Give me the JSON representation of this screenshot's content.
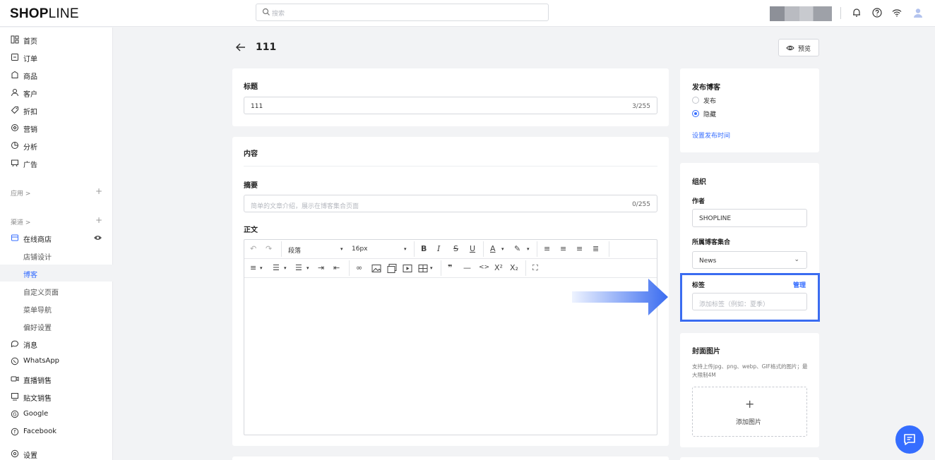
{
  "header": {
    "logo_bold": "SHOP",
    "logo_light": "LINE",
    "search_placeholder": "搜索"
  },
  "sidebar": {
    "items": [
      {
        "label": "首页",
        "icon": "home-icon"
      },
      {
        "label": "订单",
        "icon": "order-icon"
      },
      {
        "label": "商品",
        "icon": "product-icon"
      },
      {
        "label": "客户",
        "icon": "customer-icon"
      },
      {
        "label": "折扣",
        "icon": "discount-icon"
      },
      {
        "label": "营销",
        "icon": "marketing-icon"
      },
      {
        "label": "分析",
        "icon": "analytics-icon"
      },
      {
        "label": "广告",
        "icon": "ads-icon"
      }
    ],
    "apps_label": "应用 >",
    "channels_label": "渠道 >",
    "online_store": "在线商店",
    "store_subitems": [
      "店铺设计",
      "博客",
      "自定义页面",
      "菜单导航",
      "偏好设置"
    ],
    "active_subitem": "博客",
    "bottom_items": [
      {
        "label": "消息",
        "icon": "message-icon"
      },
      {
        "label": "WhatsApp",
        "icon": "whatsapp-icon"
      },
      {
        "label": "直播销售",
        "icon": "live-icon"
      },
      {
        "label": "贴文销售",
        "icon": "post-icon"
      },
      {
        "label": "Google",
        "icon": "google-icon"
      },
      {
        "label": "Facebook",
        "icon": "facebook-icon"
      }
    ],
    "settings": "设置"
  },
  "page": {
    "title": "111",
    "preview_label": "预览"
  },
  "title_card": {
    "label": "标题",
    "value": "111",
    "count": "3/255"
  },
  "content_card": {
    "heading": "内容",
    "summary_label": "摘要",
    "summary_placeholder": "简单的文章介绍，展示在博客集合页面",
    "summary_count": "0/255",
    "body_label": "正文",
    "paragraph_select": "段落",
    "fontsize_select": "16px"
  },
  "publish_card": {
    "heading": "发布博客",
    "option_publish": "发布",
    "option_hide": "隐藏",
    "selected": "隐藏",
    "schedule_link": "设置发布时间"
  },
  "org_card": {
    "heading": "组织",
    "author_label": "作者",
    "author_value": "SHOPLINE",
    "collection_label": "所属博客集合",
    "collection_value": "News",
    "tags_label": "标签",
    "tags_manage": "管理",
    "tags_placeholder": "添加标签（例如：夏季）"
  },
  "cover_card": {
    "heading": "封面图片",
    "hint": "支持上传jpg、png、webp、GIF格式的图片；最大限制4M",
    "upload_label": "添加图片"
  },
  "colors": {
    "accent": "#356dff",
    "highlight": "#3a6cf0"
  }
}
